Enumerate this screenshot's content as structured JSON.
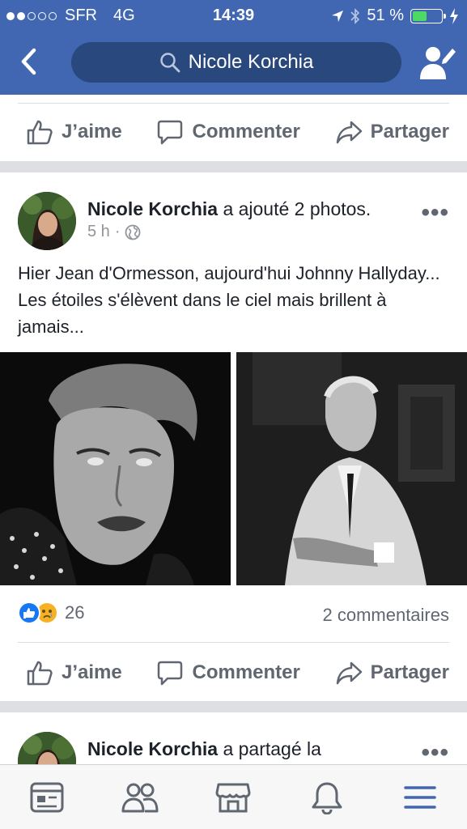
{
  "status_bar": {
    "carrier": "SFR",
    "network": "4G",
    "time": "14:39",
    "battery_percent": "51 %",
    "battery_level": 0.51,
    "signal_bars": 2
  },
  "header": {
    "search_text": "Nicole Korchia",
    "back_icon": "chevron-left-icon",
    "profile_icon": "edit-profile-icon",
    "color": "#4267b2"
  },
  "actions": {
    "like": "J’aime",
    "comment": "Commenter",
    "share": "Partager"
  },
  "post": {
    "author": "Nicole Korchia",
    "action_text": "a ajouté 2 photos.",
    "time": "5 h",
    "separator": "·",
    "text": "Hier Jean d'Ormesson, aujourd'hui Johnny Hallyday... Les étoiles s'élèvent dans le ciel mais brillent à jamais...",
    "reaction_count": "26",
    "comments": "2 commentaires"
  },
  "next_post": {
    "author": "Nicole Korchia",
    "action_text": "a partagé la"
  },
  "tabbar": {
    "items": [
      "news-feed-icon",
      "friends-icon",
      "marketplace-icon",
      "notifications-icon",
      "menu-icon"
    ],
    "active_color": "#4267b2"
  }
}
